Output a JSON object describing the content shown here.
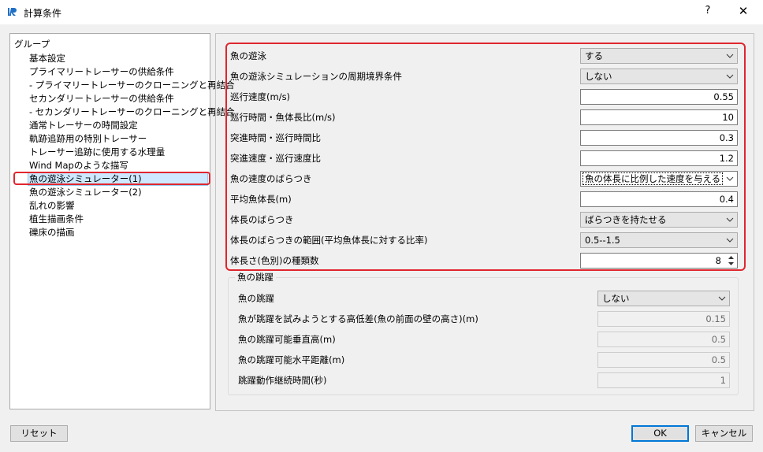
{
  "window": {
    "title": "計算条件",
    "help": "?",
    "close": "✕"
  },
  "tree": {
    "root": "グループ",
    "items": [
      "基本設定",
      "プライマリートレーサーの供給条件",
      "- プライマリートレーサーのクローニングと再結合",
      "セカンダリートレーサーの供給条件",
      "- セカンダリートレーサーのクローニングと再結合",
      "通常トレーサーの時間設定",
      "軌跡追跡用の特別トレーサー",
      "トレーサー追跡に使用する水理量",
      "Wind Mapのような描写",
      "魚の遊泳シミュレーター(1)",
      "魚の遊泳シミュレーター(2)",
      "乱れの影響",
      "植生描画条件",
      "礫床の描画"
    ],
    "selected_index": 9
  },
  "fields": {
    "swim": {
      "label": "魚の遊泳",
      "value": "する"
    },
    "periodic": {
      "label": "魚の遊泳シミュレーションの周期境界条件",
      "value": "しない"
    },
    "cruise_speed": {
      "label": "巡行速度(m/s)",
      "value": "0.55"
    },
    "cruise_time_ratio": {
      "label": "巡行時間・魚体長比(m/s)",
      "value": "10"
    },
    "dash_cruise_time": {
      "label": "突進時間・巡行時間比",
      "value": "0.3"
    },
    "dash_cruise_speed": {
      "label": "突進速度・巡行速度比",
      "value": "1.2"
    },
    "speed_variation": {
      "label": "魚の速度のばらつき",
      "value": "魚の体長に比例した速度を与える"
    },
    "mean_length": {
      "label": "平均魚体長(m)",
      "value": "0.4"
    },
    "length_variation": {
      "label": "体長のばらつき",
      "value": "ばらつきを持たせる"
    },
    "length_range": {
      "label": "体長のばらつきの範囲(平均魚体長に対する比率)",
      "value": "0.5--1.5"
    },
    "length_kinds": {
      "label": "体長さ(色別)の種類数",
      "value": "8"
    }
  },
  "jump": {
    "group_title": "魚の跳躍",
    "jump": {
      "label": "魚の跳躍",
      "value": "しない"
    },
    "height_diff": {
      "label": "魚が跳躍を試みようとする高低差(魚の前面の壁の高さ)(m)",
      "value": "0.15"
    },
    "vertical": {
      "label": "魚の跳躍可能垂直高(m)",
      "value": "0.5"
    },
    "horizontal": {
      "label": "魚の跳躍可能水平距離(m)",
      "value": "0.5"
    },
    "duration": {
      "label": "跳躍動作継続時間(秒)",
      "value": "1"
    }
  },
  "buttons": {
    "reset": "リセット",
    "ok": "OK",
    "cancel": "キャンセル"
  },
  "colors": {
    "highlight": "#e0262e",
    "selection": "#cde8ff",
    "accent": "#0078d7"
  }
}
